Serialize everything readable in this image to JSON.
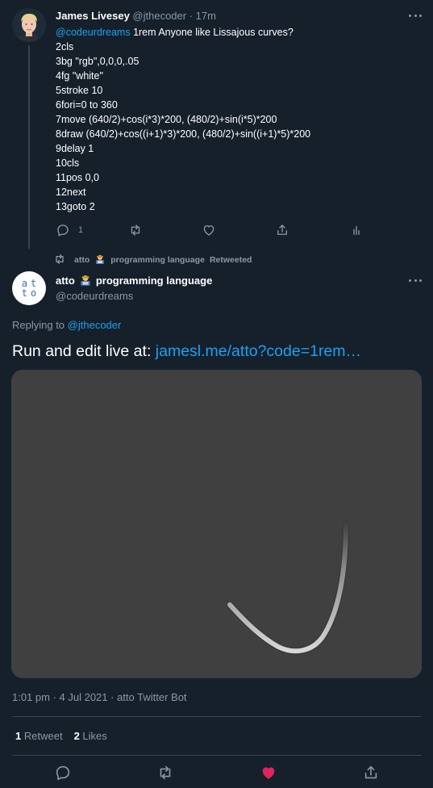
{
  "tweet1": {
    "name": "James Livesey",
    "handle": "@jthecoder",
    "time": "· 17m",
    "mention": "@codeurdreams",
    "first_line_rest": " 1rem Anyone like Lissajous curves?",
    "code_lines": [
      "2cls",
      "3bg \"rgb\",0,0,0,.05",
      "4fg \"white\"",
      "5stroke 10",
      "6fori=0 to 360",
      "7move (640/2)+cos(i*3)*200, (480/2)+sin(i*5)*200",
      "8draw (640/2)+cos((i+1)*3)*200, (480/2)+sin((i+1)*5)*200",
      "9delay 1",
      "10cls",
      "11pos 0,0",
      "12next",
      "13goto 2"
    ],
    "reply_count": "1"
  },
  "retweet_bar": {
    "name_prefix": "atto",
    "name_suffix": "programming language",
    "label": "Retweeted"
  },
  "tweet2": {
    "avatar_line1": "at",
    "avatar_line2": "to",
    "name_prefix": "atto",
    "name_suffix": "programming language",
    "handle": "@codeurdreams",
    "replying_prefix": "Replying to ",
    "replying_handle": "@jthecoder",
    "text_prefix": "Run and edit live at: ",
    "text_link": "jamesl.me/atto?code=1rem…",
    "meta": "1:01 pm · 4 Jul 2021 · atto Twitter Bot",
    "retweets": {
      "count": "1",
      "label": "Retweet"
    },
    "likes": {
      "count": "2",
      "label": "Likes"
    },
    "liked": true
  },
  "colors": {
    "background": "#15202b",
    "accent": "#1da1f2",
    "muted": "#8899a6",
    "like": "#e0245e",
    "media_bg": "#404040"
  },
  "icons": [
    "more-icon",
    "reply-icon",
    "retweet-icon",
    "like-icon",
    "share-icon",
    "analytics-icon",
    "technologist-emoji"
  ]
}
